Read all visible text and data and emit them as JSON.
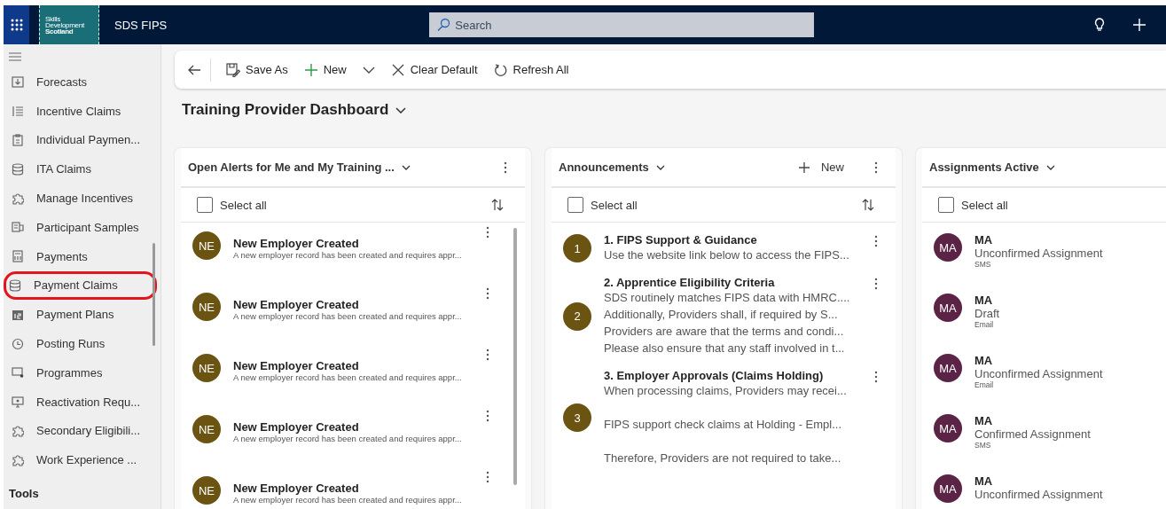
{
  "header": {
    "logo_lines": [
      "Skills",
      "Development",
      "Scotland"
    ],
    "app_name": "SDS FIPS",
    "search": {
      "placeholder": "Search"
    }
  },
  "sidebar": {
    "items": [
      {
        "label": "Forecasts",
        "highlighted": false
      },
      {
        "label": "Incentive Claims",
        "highlighted": false
      },
      {
        "label": "Individual Paymen...",
        "highlighted": false
      },
      {
        "label": "ITA Claims",
        "highlighted": false
      },
      {
        "label": "Manage Incentives",
        "highlighted": false
      },
      {
        "label": "Participant Samples",
        "highlighted": false
      },
      {
        "label": "Payments",
        "highlighted": false
      },
      {
        "label": "Payment Claims",
        "highlighted": true
      },
      {
        "label": "Payment Plans",
        "highlighted": false
      },
      {
        "label": "Posting Runs",
        "highlighted": false
      },
      {
        "label": "Programmes",
        "highlighted": false
      },
      {
        "label": "Reactivation Requ...",
        "highlighted": false
      },
      {
        "label": "Secondary Eligibili...",
        "highlighted": false
      },
      {
        "label": "Work Experience ...",
        "highlighted": false
      }
    ],
    "section": "Tools"
  },
  "command_bar": [
    {
      "label": "Save As",
      "dropdown": false
    },
    {
      "label": "New",
      "dropdown": true
    },
    {
      "label": "Clear Default",
      "dropdown": false
    },
    {
      "label": "Refresh All",
      "dropdown": false
    }
  ],
  "dashboard_title": "Training Provider Dashboard",
  "cards": [
    {
      "kind": "alerts",
      "title": "Open Alerts for Me and My Training ...",
      "more": true,
      "select_all": {
        "label": "Select all",
        "checked": false
      },
      "sort": true,
      "items": [
        {
          "avatar": "NE",
          "title": "New Employer Created",
          "summary": "A new employer record has been created and requires appr..."
        },
        {
          "avatar": "NE",
          "title": "New Employer Created",
          "summary": "A new employer record has been created and requires appr..."
        },
        {
          "avatar": "NE",
          "title": "New Employer Created",
          "summary": "A new employer record has been created and requires appr..."
        },
        {
          "avatar": "NE",
          "title": "New Employer Created",
          "summary": "A new employer record has been created and requires appr..."
        },
        {
          "avatar": "NE",
          "title": "New Employer Created",
          "summary": "A new employer record has been created and requires appr..."
        }
      ]
    },
    {
      "kind": "announcements",
      "title": "Announcements",
      "new_label": "New",
      "more": true,
      "select_all": {
        "label": "Select all",
        "checked": false
      },
      "sort": true,
      "items": [
        {
          "avatar": "1",
          "title": "1. FIPS Support & Guidance",
          "lines": [
            {
              "text": "Use the website link below to access the FIPS...",
              "spaced": false
            }
          ]
        },
        {
          "avatar": "2",
          "title": "2. Apprentice Eligibility Criteria",
          "lines": [
            {
              "text": "SDS routinely matches FIPS data with HMRC....",
              "spaced": false
            },
            {
              "text": "Additionally, Providers shall, if required by S...",
              "spaced": false
            },
            {
              "text": "Providers are aware that the terms and condi...",
              "spaced": false
            },
            {
              "text": "Please also ensure that any staff involved in t...",
              "spaced": false
            }
          ]
        },
        {
          "avatar": "3",
          "title": "3. Employer Approvals (Claims Holding)",
          "lines": [
            {
              "text": "When processing claims, Providers may recei...",
              "spaced": false
            },
            {
              "text": "FIPS support check claims at Holding - Empl...",
              "spaced": true
            },
            {
              "text": "Therefore, Providers are not required to take...",
              "spaced": true
            }
          ]
        }
      ]
    },
    {
      "kind": "assignments",
      "title": "Assignments Active",
      "more": false,
      "select_all": {
        "label": "Select all",
        "checked": false
      },
      "sort": false,
      "items": [
        {
          "avatar": "MA",
          "name": "MA",
          "status": "Unconfirmed Assignment",
          "channel": "SMS"
        },
        {
          "avatar": "MA",
          "name": "MA",
          "status": "Draft",
          "channel": "Email"
        },
        {
          "avatar": "MA",
          "name": "MA",
          "status": "Unconfirmed Assignment",
          "channel": "Email"
        },
        {
          "avatar": "MA",
          "name": "MA",
          "status": "Confirmed Assignment",
          "channel": "SMS"
        },
        {
          "avatar": "MA",
          "name": "MA",
          "status": "Unconfirmed Assignment"
        }
      ]
    }
  ]
}
